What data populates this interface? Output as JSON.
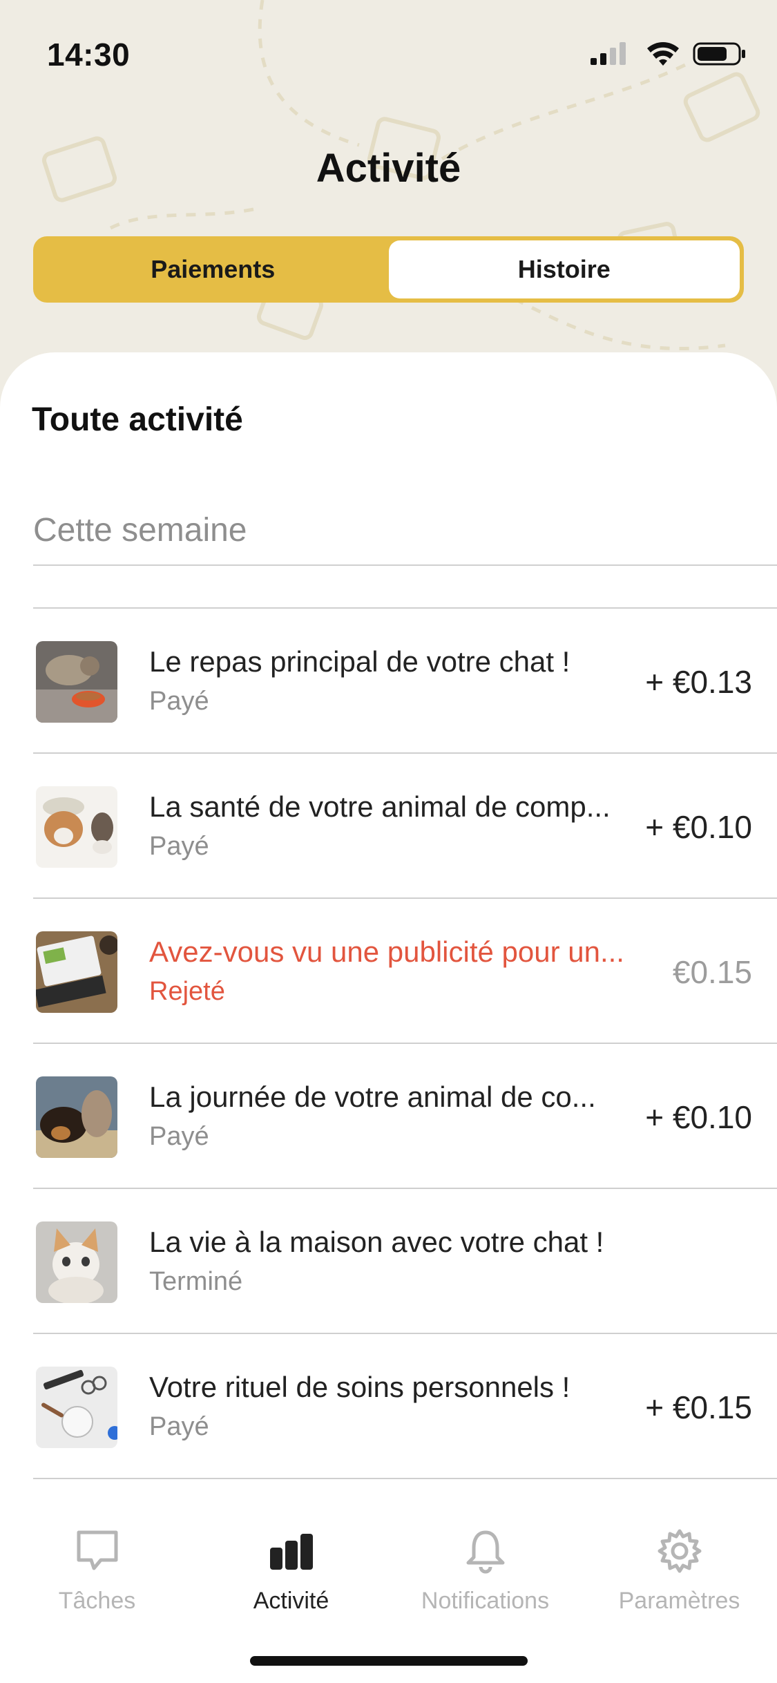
{
  "status_bar": {
    "time": "14:30"
  },
  "header": {
    "title": "Activité"
  },
  "segment": {
    "items": [
      {
        "label": "Paiements",
        "active": false
      },
      {
        "label": "Histoire",
        "active": true
      }
    ]
  },
  "main": {
    "section_title": "Toute activité",
    "week_label": "Cette semaine",
    "activities": [
      {
        "title": "Le repas principal de votre chat !",
        "status": "Payé",
        "amount": "+ €0.13",
        "thumb": "cat-eating-image"
      },
      {
        "title": "La santé de votre animal de comp...",
        "status": "Payé",
        "amount": "+ €0.10",
        "thumb": "puppy-image"
      },
      {
        "title": "Avez-vous vu une publicité pour un...",
        "status": "Rejeté",
        "amount": "€0.15",
        "thumb": "laptop-ad-image"
      },
      {
        "title": "La journée de votre animal de co...",
        "status": "Payé",
        "amount": "+ €0.10",
        "thumb": "dog-and-cat-image"
      },
      {
        "title": "La vie à la maison avec votre chat !",
        "status": "Terminé",
        "amount": "",
        "thumb": "kitten-image"
      },
      {
        "title": "Votre rituel de soins personnels !",
        "status": "Payé",
        "amount": "+ €0.15",
        "thumb": "grooming-tools-image"
      }
    ]
  },
  "tabbar": {
    "tabs": [
      {
        "label": "Tâches",
        "icon": "chat-bubble-icon",
        "active": false
      },
      {
        "label": "Activité",
        "icon": "bar-chart-icon",
        "active": true
      },
      {
        "label": "Notifications",
        "icon": "bell-icon",
        "active": false
      },
      {
        "label": "Paramètres",
        "icon": "gear-icon",
        "active": false
      }
    ]
  },
  "colors": {
    "accent": "#E5BD45",
    "background": "#EFECE3",
    "rejected": "#E2553E",
    "muted": "#8E8E8E"
  }
}
